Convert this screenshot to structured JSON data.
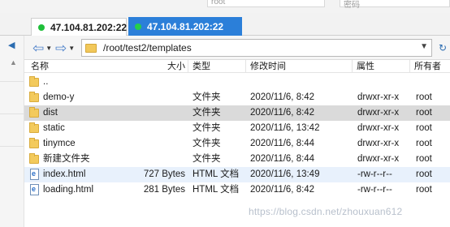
{
  "top_fields": {
    "left_field": "root",
    "right_field": "密码"
  },
  "tabs": [
    {
      "label": "47.104.81.202:22",
      "active": false
    },
    {
      "label": "47.104.81.202:22",
      "active": true
    }
  ],
  "toolbar": {
    "path": "/root/test2/templates"
  },
  "columns": [
    "名称",
    "大小",
    "类型",
    "修改时间",
    "属性",
    "所有者"
  ],
  "files": [
    {
      "name": "..",
      "size": "",
      "type": "",
      "modified": "",
      "attrs": "",
      "owner": "",
      "kind": "folder"
    },
    {
      "name": "demo-y",
      "size": "",
      "type": "文件夹",
      "modified": "2020/11/6, 8:42",
      "attrs": "drwxr-xr-x",
      "owner": "root",
      "kind": "folder"
    },
    {
      "name": "dist",
      "size": "",
      "type": "文件夹",
      "modified": "2020/11/6, 8:42",
      "attrs": "drwxr-xr-x",
      "owner": "root",
      "kind": "folder",
      "selected": true
    },
    {
      "name": "static",
      "size": "",
      "type": "文件夹",
      "modified": "2020/11/6, 13:42",
      "attrs": "drwxr-xr-x",
      "owner": "root",
      "kind": "folder"
    },
    {
      "name": "tinymce",
      "size": "",
      "type": "文件夹",
      "modified": "2020/11/6, 8:44",
      "attrs": "drwxr-xr-x",
      "owner": "root",
      "kind": "folder"
    },
    {
      "name": "新建文件夹",
      "size": "",
      "type": "文件夹",
      "modified": "2020/11/6, 8:44",
      "attrs": "drwxr-xr-x",
      "owner": "root",
      "kind": "folder"
    },
    {
      "name": "index.html",
      "size": "727 Bytes",
      "type": "HTML 文档",
      "modified": "2020/11/6, 13:49",
      "attrs": "-rw-r--r--",
      "owner": "root",
      "kind": "html",
      "hover": true
    },
    {
      "name": "loading.html",
      "size": "281 Bytes",
      "type": "HTML 文档",
      "modified": "2020/11/6, 8:42",
      "attrs": "-rw-r--r--",
      "owner": "root",
      "kind": "html"
    }
  ],
  "watermark": "https://blog.csdn.net/zhouxuan612"
}
